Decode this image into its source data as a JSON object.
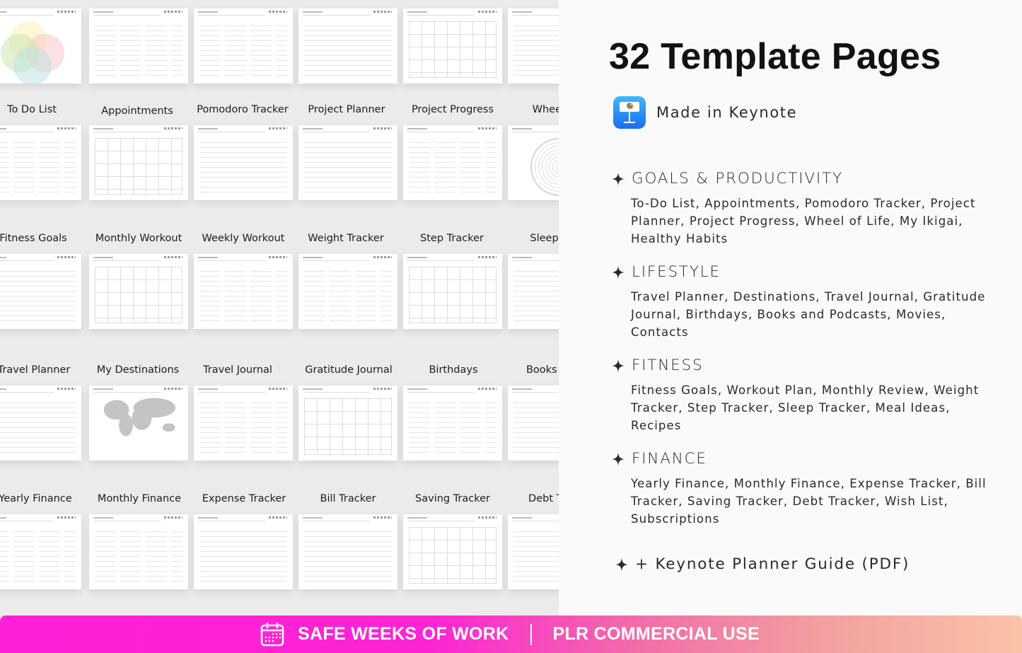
{
  "title": "32 Template Pages",
  "made_in": {
    "icon": "keynote-app-icon",
    "label": "Made in Keynote"
  },
  "thumbnails": {
    "rows": [
      {
        "labels": [
          "To Do List",
          "Appointments",
          "Pomodoro Tracker",
          "Project Planner",
          "Project Progress",
          "Wheel of Life"
        ]
      },
      {
        "labels": [
          "Fitness Goals",
          "Monthly Workout",
          "Weekly Workout",
          "Weight Tracker",
          "Step Tracker",
          "Sleep Tracker"
        ]
      },
      {
        "labels": [
          "Travel Planner",
          "My Destinations",
          "Travel Journal",
          "Gratitude Journal",
          "Birthdays",
          "Books & Podcasts"
        ]
      },
      {
        "labels": [
          "Yearly Finance",
          "Monthly Finance",
          "Expense Tracker",
          "Bill Tracker",
          "Saving Tracker",
          "Debt Tracker"
        ]
      }
    ]
  },
  "sections": [
    {
      "icon": "sparkle-icon",
      "heading": "GOALS & PRODUCTIVITY",
      "body": "To-Do List, Appointments, Pomodoro Tracker, Project Planner, Project Progress, Wheel of Life, My Ikigai, Healthy Habits"
    },
    {
      "icon": "sparkle-icon",
      "heading": "LIFESTYLE",
      "body": "Travel Planner, Destinations, Travel Journal, Gratitude Journal, Birthdays, Books and Podcasts, Movies, Contacts"
    },
    {
      "icon": "sparkle-icon",
      "heading": "FITNESS",
      "body": "Fitness Goals, Workout Plan, Monthly Review, Weight Tracker, Step Tracker, Sleep Tracker, Meal Ideas, Recipes"
    },
    {
      "icon": "sparkle-icon",
      "heading": "FINANCE",
      "body": "Yearly Finance, Monthly Finance, Expense Tracker, Bill Tracker, Saving Tracker, Debt Tracker, Wish List, Subscriptions"
    }
  ],
  "guide": {
    "icon": "sparkle-icon",
    "label": "+ Keynote Planner Guide (PDF)"
  },
  "banner": {
    "icon": "calendar-icon",
    "left_label": "SAFE WEEKS OF WORK",
    "right_label": "PLR COMMERCIAL USE",
    "colors": {
      "start": "#fe1fd8",
      "end": "#fac3a6"
    }
  }
}
